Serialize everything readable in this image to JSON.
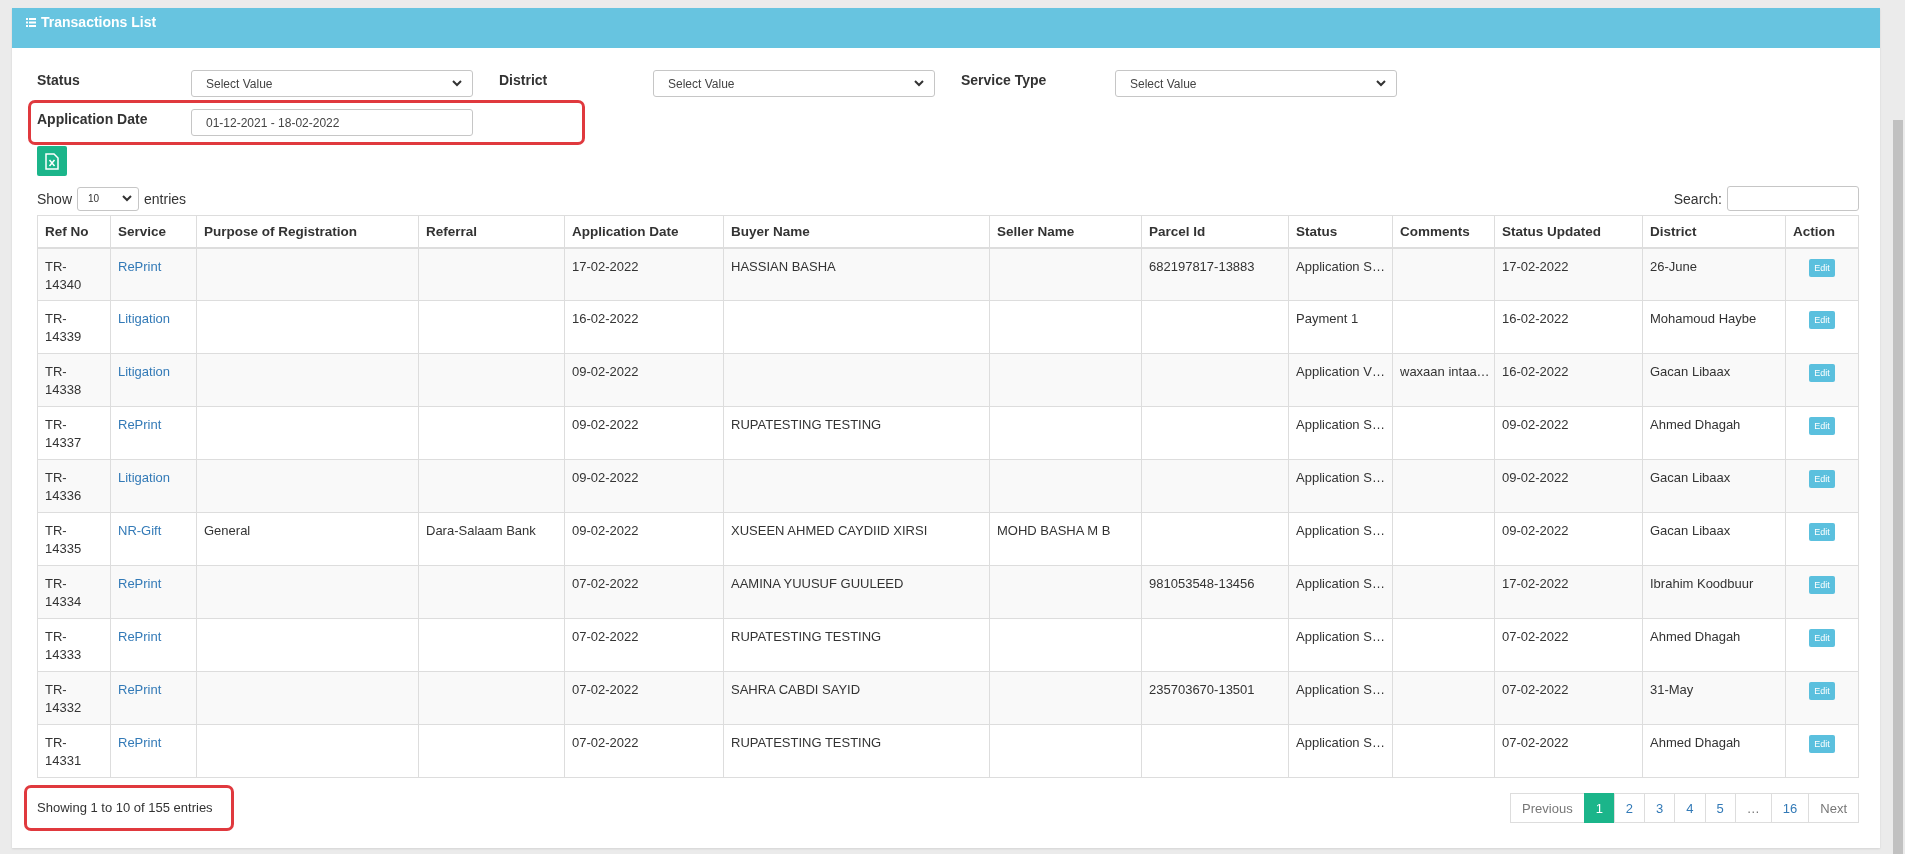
{
  "panel": {
    "title": "Transactions List"
  },
  "filters": [
    {
      "kind": "select",
      "label": "Status",
      "value": "Select Value",
      "highlighted": false
    },
    {
      "kind": "select",
      "label": "District",
      "value": "Select Value",
      "highlighted": false
    },
    {
      "kind": "select",
      "label": "Service Type",
      "value": "Select Value",
      "highlighted": false
    },
    {
      "kind": "date",
      "label": "Application Date",
      "value": "01-12-2021 - 18-02-2022",
      "highlighted": true
    }
  ],
  "length": {
    "before": "Show",
    "value": "10",
    "after": "entries"
  },
  "search": {
    "label": "Search:"
  },
  "table": {
    "columns": [
      "Ref No",
      "Service",
      "Purpose of Registration",
      "Referral",
      "Application Date",
      "Buyer Name",
      "Seller Name",
      "Parcel Id",
      "Status",
      "Comments",
      "Status Updated",
      "District",
      "Action"
    ],
    "rows": [
      {
        "ref": "TR-14340",
        "service": "RePrint",
        "purpose": "",
        "referral": "",
        "date": "17-02-2022",
        "buyer": "HASSIAN BASHA",
        "seller": "",
        "parcel": "682197817-13883",
        "status": "Application S…",
        "comments": "",
        "updated": "17-02-2022",
        "district": "26-June",
        "action": "Edit"
      },
      {
        "ref": "TR-14339",
        "service": "Litigation",
        "purpose": "",
        "referral": "",
        "date": "16-02-2022",
        "buyer": "",
        "seller": "",
        "parcel": "",
        "status": "Payment 1",
        "comments": "",
        "updated": "16-02-2022",
        "district": "Mohamoud Haybe",
        "action": "Edit"
      },
      {
        "ref": "TR-14338",
        "service": "Litigation",
        "purpose": "",
        "referral": "",
        "date": "09-02-2022",
        "buyer": "",
        "seller": "",
        "parcel": "",
        "status": "Application V…",
        "comments": "waxaan intaa…",
        "updated": "16-02-2022",
        "district": "Gacan Libaax",
        "action": "Edit"
      },
      {
        "ref": "TR-14337",
        "service": "RePrint",
        "purpose": "",
        "referral": "",
        "date": "09-02-2022",
        "buyer": "RUPATESTING TESTING",
        "seller": "",
        "parcel": "",
        "status": "Application S…",
        "comments": "",
        "updated": "09-02-2022",
        "district": "Ahmed Dhagah",
        "action": "Edit"
      },
      {
        "ref": "TR-14336",
        "service": "Litigation",
        "purpose": "",
        "referral": "",
        "date": "09-02-2022",
        "buyer": "",
        "seller": "",
        "parcel": "",
        "status": "Application S…",
        "comments": "",
        "updated": "09-02-2022",
        "district": "Gacan Libaax",
        "action": "Edit"
      },
      {
        "ref": "TR-14335",
        "service": "NR-Gift",
        "purpose": "General",
        "referral": "Dara-Salaam Bank",
        "date": "09-02-2022",
        "buyer": "XUSEEN AHMED CAYDIID XIRSI",
        "seller": "MOHD BASHA M B",
        "parcel": "",
        "status": "Application S…",
        "comments": "",
        "updated": "09-02-2022",
        "district": "Gacan Libaax",
        "action": "Edit"
      },
      {
        "ref": "TR-14334",
        "service": "RePrint",
        "purpose": "",
        "referral": "",
        "date": "07-02-2022",
        "buyer": "AAMINA YUUSUF GUULEED",
        "seller": "",
        "parcel": "981053548-13456",
        "status": "Application S…",
        "comments": "",
        "updated": "17-02-2022",
        "district": "Ibrahim Koodbuur",
        "action": "Edit"
      },
      {
        "ref": "TR-14333",
        "service": "RePrint",
        "purpose": "",
        "referral": "",
        "date": "07-02-2022",
        "buyer": "RUPATESTING TESTING",
        "seller": "",
        "parcel": "",
        "status": "Application S…",
        "comments": "",
        "updated": "07-02-2022",
        "district": "Ahmed Dhagah",
        "action": "Edit"
      },
      {
        "ref": "TR-14332",
        "service": "RePrint",
        "purpose": "",
        "referral": "",
        "date": "07-02-2022",
        "buyer": "SAHRA CABDI SAYID",
        "seller": "",
        "parcel": "235703670-13501",
        "status": "Application S…",
        "comments": "",
        "updated": "07-02-2022",
        "district": "31-May",
        "action": "Edit"
      },
      {
        "ref": "TR-14331",
        "service": "RePrint",
        "purpose": "",
        "referral": "",
        "date": "07-02-2022",
        "buyer": "RUPATESTING TESTING",
        "seller": "",
        "parcel": "",
        "status": "Application S…",
        "comments": "",
        "updated": "07-02-2022",
        "district": "Ahmed Dhagah",
        "action": "Edit"
      }
    ]
  },
  "info": {
    "text": "Showing 1 to 10 of 155 entries",
    "highlighted": true
  },
  "pagination": [
    {
      "kind": "nav",
      "label": "Previous",
      "selected": false
    },
    {
      "kind": "page",
      "label": "1",
      "selected": true
    },
    {
      "kind": "page",
      "label": "2",
      "selected": false
    },
    {
      "kind": "page",
      "label": "3",
      "selected": false
    },
    {
      "kind": "page",
      "label": "4",
      "selected": false
    },
    {
      "kind": "page",
      "label": "5",
      "selected": false
    },
    {
      "kind": "gap",
      "label": "…",
      "selected": false
    },
    {
      "kind": "page",
      "label": "16",
      "selected": false
    },
    {
      "kind": "nav",
      "label": "Next",
      "selected": false
    }
  ]
}
